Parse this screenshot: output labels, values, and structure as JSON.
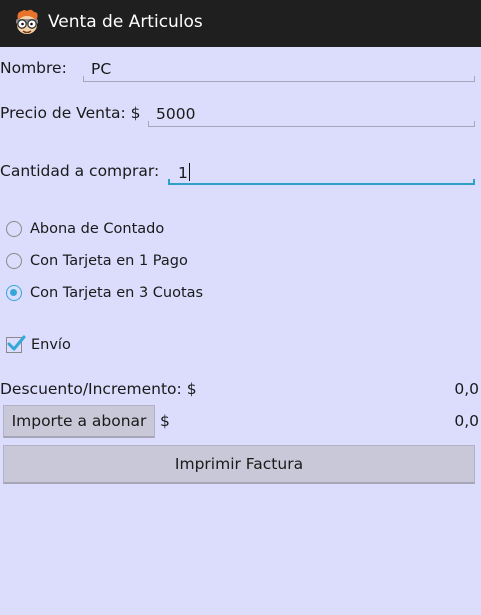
{
  "app": {
    "title": "Venta de Articulos",
    "icon": "dexter-face-icon"
  },
  "form": {
    "nombre_label": "Nombre:",
    "nombre_value": "PC",
    "precio_label": "Precio de Venta: $",
    "precio_value": "5000",
    "cantidad_label": "Cantidad a comprar:",
    "cantidad_value": "1",
    "payment_options": [
      {
        "label": "Abona de Contado",
        "checked": false
      },
      {
        "label": "Con Tarjeta en 1 Pago",
        "checked": false
      },
      {
        "label": "Con Tarjeta en 3 Cuotas",
        "checked": true
      }
    ],
    "envio_label": "Envío",
    "envio_checked": true,
    "descuento_label": "Descuento/Incremento:  $",
    "descuento_value": "0,0",
    "importe_button": "Importe a abonar",
    "importe_currency": "$",
    "importe_value": "0,0",
    "imprimir_button": "Imprimir Factura"
  },
  "colors": {
    "background": "#dcdcfc",
    "titlebar": "#1f1f1f",
    "accent": "#33a8d8",
    "button": "#c8c8d8"
  }
}
